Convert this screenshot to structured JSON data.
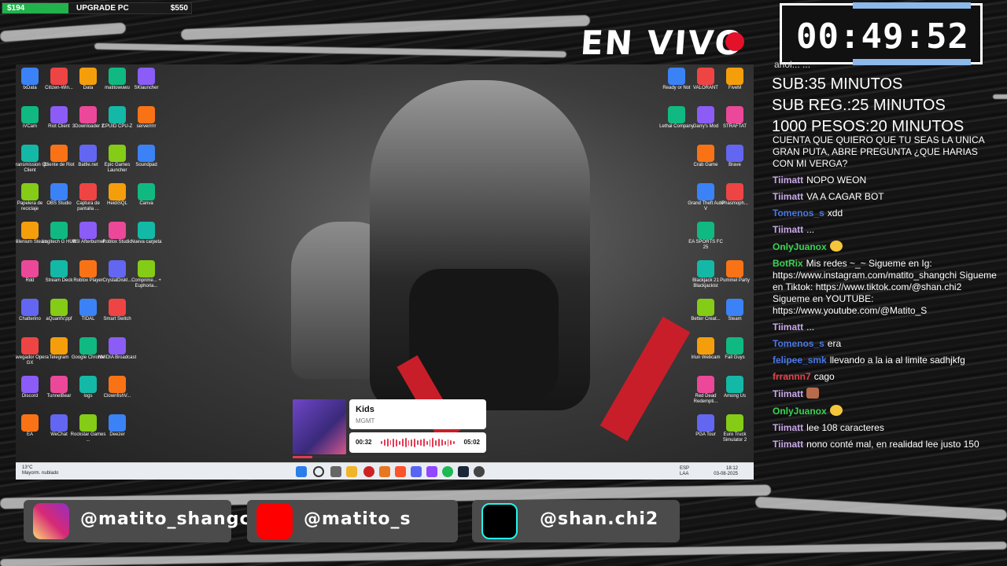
{
  "goal": {
    "current": "$194",
    "label": "UPGRADE PC",
    "target": "$550",
    "progress": 0.35
  },
  "live_label": "EN VIVO",
  "timer": "00:49:52",
  "rules_partial": "ahol... ...",
  "rules": [
    "SUB:35 MINUTOS",
    "SUB REG.:25 MINUTOS",
    "1000 PESOS:20 MINUTOS"
  ],
  "chat": [
    {
      "user": "",
      "text": "CUENTA QUE QUIERO QUE TU SEAS LA UNICA GRAN PUTA, ABRE PREGUNTA ¿QUE HARIAS CON MI VERGA?",
      "color": "#ffffff"
    },
    {
      "user": "Tiimatt",
      "text": "NOPO WEON",
      "color": "#c8a8e8"
    },
    {
      "user": "Tiimatt",
      "text": "VA A CAGAR BOT",
      "color": "#c8a8e8"
    },
    {
      "user": "Tomenos_s",
      "text": "xdd",
      "color": "#4a78e8"
    },
    {
      "user": "Tiimatt",
      "text": "...",
      "color": "#c8a8e8"
    },
    {
      "user": "OnlyJuanox",
      "text": "",
      "color": "#39d353",
      "emote": "yellow"
    },
    {
      "user": "BotRix",
      "text": "Mis redes ~_~ Sigueme en Ig: https://www.instagram.com/matito_shangchi Sigueme en Tiktok: https://www.tiktok.com/@shan.chi2 Sigueme en YOUTUBE: https://www.youtube.com/@Matito_S",
      "color": "#39d353"
    },
    {
      "user": "Tiimatt",
      "text": "...",
      "color": "#c8a8e8"
    },
    {
      "user": "Tomenos_s",
      "text": "era",
      "color": "#4a78e8"
    },
    {
      "user": "felipee_smk",
      "text": "llevando a la ia al limite sadhjkfg",
      "color": "#4a78e8"
    },
    {
      "user": "frrannn7",
      "text": "cago",
      "color": "#e8414a"
    },
    {
      "user": "Tiimatt",
      "text": "",
      "color": "#c8a8e8",
      "emote": "face"
    },
    {
      "user": "OnlyJuanox",
      "text": "",
      "color": "#39d353",
      "emote": "yellow"
    },
    {
      "user": "Tiimatt",
      "text": "lee 108 caracteres",
      "color": "#c8a8e8"
    },
    {
      "user": "Tiimatt",
      "text": "nono conté mal, en realidad lee justo 150",
      "color": "#c8a8e8"
    }
  ],
  "music": {
    "title": "Kids",
    "artist": "MGMT",
    "elapsed": "00:32",
    "total": "05:02",
    "progress": 0.1
  },
  "taskbar": {
    "weather_temp": "13°C",
    "weather_desc": "Mayorm. nublado",
    "lang": "ESP",
    "lang2": "LAA",
    "time": "18:12",
    "date": "03-08-2025"
  },
  "socials": [
    {
      "name": "instagram",
      "handle": "@matito_shangchi",
      "color": "#e1306c"
    },
    {
      "name": "youtube",
      "handle": "@matito_s",
      "color": "#ff0000"
    },
    {
      "name": "tiktok",
      "handle": "@shan.chi2",
      "color": "#000000"
    }
  ],
  "desktop_icons": {
    "left": [
      [
        "txData",
        "Citizen-Win...",
        "Data",
        "matitowuwu",
        "SKlauncher"
      ],
      [
        "iVCam",
        "Riot Client",
        "3Downloader 2",
        "CPUID CPU-Z",
        "serverrrrr"
      ],
      [
        "Transmission Qt Client",
        "Cliente de Riot",
        "Battle.net",
        "Epic Games Launcher",
        "Soundpad"
      ],
      [
        "Papelera de reciclaje",
        "OBS Studio",
        "Captura de pantalla ...",
        "HeidiSQL",
        "Canva"
      ],
      [
        "Millenium Steam",
        "Logitech G HUB",
        "MSI Afterburner",
        "Roblox Studio",
        "Nueva carpeta"
      ],
      [
        "Rdd",
        "Stream Deck",
        "Roblox Player",
        "CrystalDiskI...",
        "Comprime... + Euphoria..."
      ],
      [
        "Chatterino",
        "aQuantV.ppf",
        "TIDAL",
        "Smart Switch",
        ""
      ],
      [
        "Navegador Opera GX",
        "Telegram",
        "Google Chrome",
        "NVIDIA Broadcast",
        ""
      ],
      [
        "Discord",
        "TunnelBear",
        "logs",
        "ClownfishV...",
        ""
      ],
      [
        "EA",
        "WeChat",
        "Rockstar Games ...",
        "Deezer",
        ""
      ]
    ],
    "right": [
      [
        "Ready or Not",
        "VALORANT",
        "FiveM"
      ],
      [
        "Lethal Company",
        "Garry's Mod",
        "STRAFTAT"
      ],
      [
        "",
        "Crab Game",
        "Brave"
      ],
      [
        "",
        "Grand Theft Auto V",
        "Phasmoph..."
      ],
      [
        "",
        "EA SPORTS FC 25",
        ""
      ],
      [
        "",
        "Blackjack 21 Blackjackist",
        "Pummel Party"
      ],
      [
        "",
        "Better Creat...",
        "Steam"
      ],
      [
        "",
        "Iriun Webcam",
        "Fall Guys"
      ],
      [
        "",
        "Red Dead Redempti...",
        "Among Us"
      ],
      [
        "",
        "PGA Tour",
        "Euro Truck Simulator 2"
      ]
    ]
  }
}
